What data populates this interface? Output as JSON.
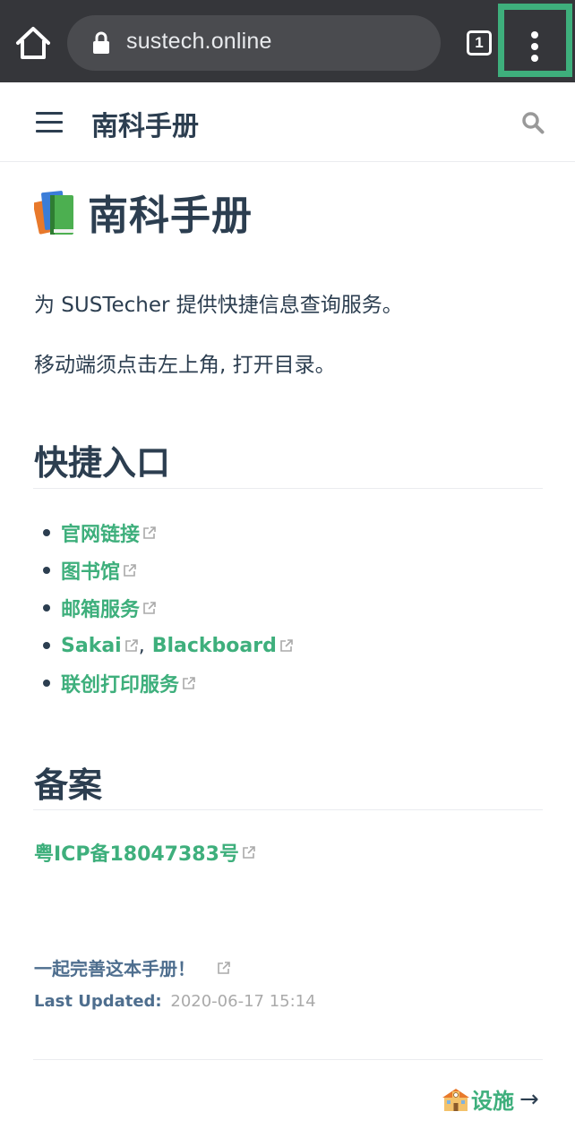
{
  "browser": {
    "url": "sustech.online",
    "tab_count": "1"
  },
  "header": {
    "site_title": "南科手册"
  },
  "page": {
    "title": "南科手册",
    "intro": "为 SUSTecher 提供快捷信息查询服务。",
    "mobile_hint": "移动端须点击左上角, 打开目录。",
    "quick_heading": "快捷入口",
    "links": {
      "official": "官网链接",
      "library": "图书馆",
      "mail": "邮箱服务",
      "sakai": "Sakai",
      "separator": ",",
      "blackboard": "Blackboard",
      "print": "联创打印服务"
    },
    "record_heading": "备案",
    "icp": "粤ICP备18047383号",
    "edit_link": "一起完善这本手册！",
    "last_updated_label": "Last Updated:",
    "last_updated_value": "2020-06-17 15:14",
    "next_label": "设施",
    "next_arrow": "→"
  },
  "colors": {
    "browser_chrome": "#35363a",
    "accent_green": "#3eaf7c",
    "text": "#2c3e50",
    "muted": "#aaaaaa"
  },
  "icons": [
    "home-icon",
    "lock-icon",
    "tab-switcher",
    "more-vert-icon",
    "hamburger-icon",
    "search-icon",
    "books-icon",
    "external-link-icon",
    "school-icon"
  ]
}
